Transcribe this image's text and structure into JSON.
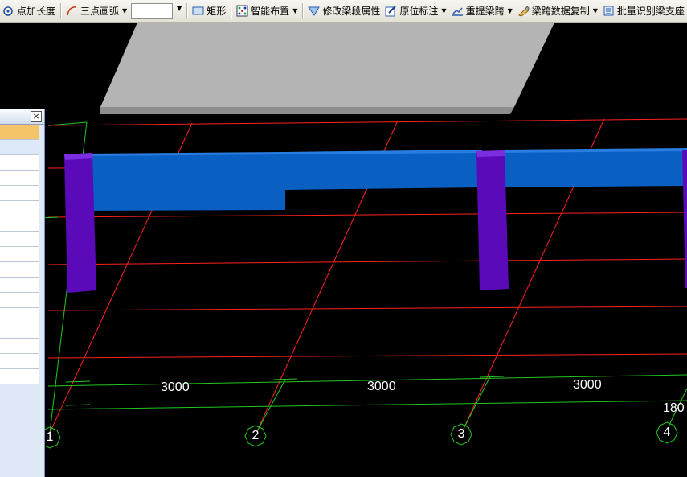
{
  "toolbar": {
    "items": [
      {
        "label": "点加长度",
        "icon": "point-length-icon",
        "dropdown": false
      },
      {
        "label": "三点画弧",
        "icon": "three-point-arc-icon",
        "dropdown": true
      },
      {
        "label": "矩形",
        "icon": "rectangle-icon",
        "dropdown": false
      },
      {
        "label": "智能布置",
        "icon": "smart-layout-icon",
        "dropdown": true
      },
      {
        "label": "修改梁段属性",
        "icon": "modify-beam-icon",
        "dropdown": false
      },
      {
        "label": "原位标注",
        "icon": "inplace-annotation-icon",
        "dropdown": true
      },
      {
        "label": "重提梁跨",
        "icon": "reextract-span-icon",
        "dropdown": true
      },
      {
        "label": "梁跨数据复制",
        "icon": "copy-span-data-icon",
        "dropdown": true
      },
      {
        "label": "批量识别梁支座",
        "icon": "batch-identify-icon",
        "dropdown": false
      }
    ]
  },
  "panel": {
    "close_icon": "×"
  },
  "drawing": {
    "dimensions": [
      "3000",
      "3000",
      "3000",
      "180"
    ],
    "axes": [
      "1",
      "2",
      "3",
      "4"
    ]
  },
  "colors": {
    "beam": "#0a5fc3",
    "column": "#5a0ab8",
    "slab": "#b4b4b4",
    "grid_red": "#ff2020",
    "grid_green": "#22c722"
  }
}
